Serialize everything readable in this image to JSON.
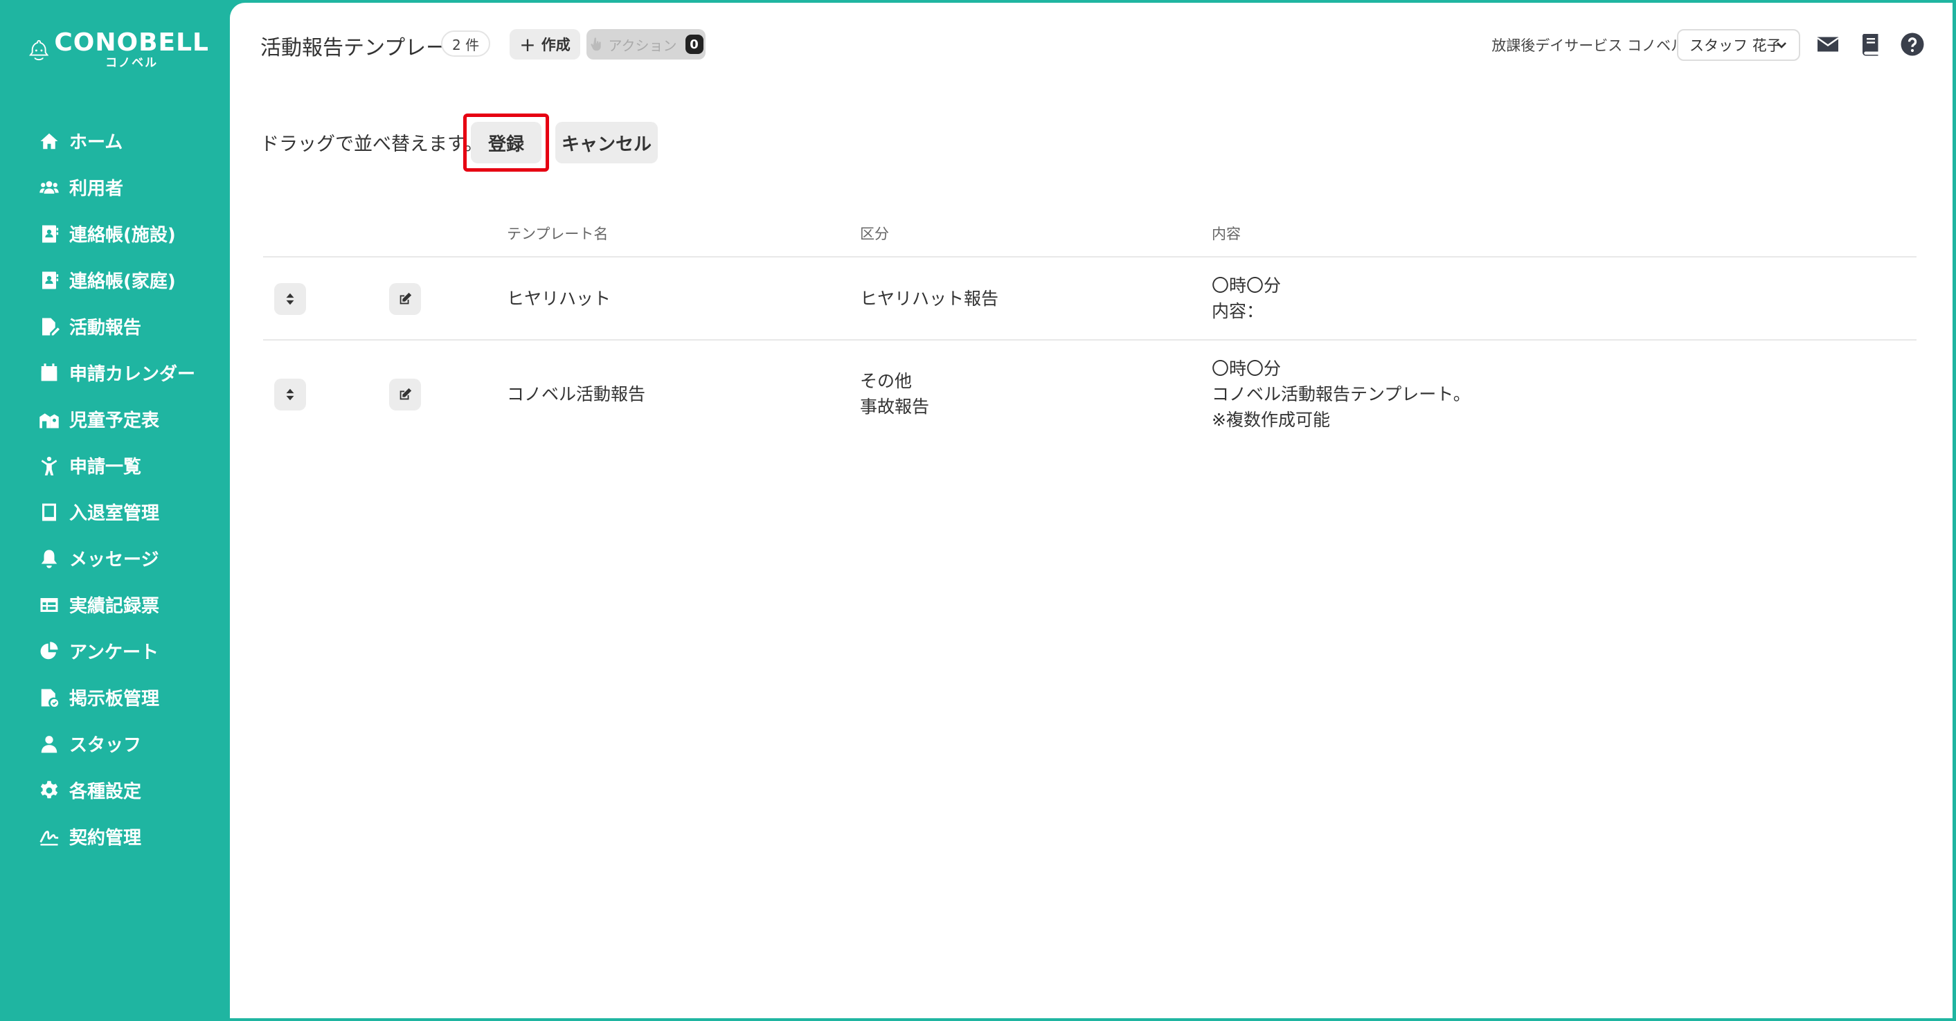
{
  "brand": {
    "name": "CONOBELL",
    "sub": "コノベル"
  },
  "sidebar": {
    "items": [
      {
        "label": "ホーム",
        "icon": "home-icon"
      },
      {
        "label": "利用者",
        "icon": "users-icon"
      },
      {
        "label": "連絡帳(施設)",
        "icon": "contact-book-icon"
      },
      {
        "label": "連絡帳(家庭)",
        "icon": "contact-book-icon"
      },
      {
        "label": "活動報告",
        "icon": "activity-report-icon"
      },
      {
        "label": "申請カレンダー",
        "icon": "calendar-icon"
      },
      {
        "label": "児童予定表",
        "icon": "schedule-icon"
      },
      {
        "label": "申請一覧",
        "icon": "child-icon"
      },
      {
        "label": "入退室管理",
        "icon": "tablet-icon"
      },
      {
        "label": "メッセージ",
        "icon": "bell-icon"
      },
      {
        "label": "実績記録票",
        "icon": "table-icon"
      },
      {
        "label": "アンケート",
        "icon": "pie-chart-icon"
      },
      {
        "label": "掲示板管理",
        "icon": "board-icon"
      },
      {
        "label": "スタッフ",
        "icon": "staff-icon"
      },
      {
        "label": "各種設定",
        "icon": "gear-icon"
      },
      {
        "label": "契約管理",
        "icon": "contract-icon"
      }
    ]
  },
  "header": {
    "title": "活動報告テンプレート",
    "count": "2 件",
    "create_label": "作成",
    "action_label": "アクション",
    "action_count": "0",
    "facility": "放課後デイサービス コノベル",
    "staff_name": "スタッフ 花子"
  },
  "sort": {
    "hint": "ドラッグで並べ替えます。",
    "register_label": "登録",
    "cancel_label": "キャンセル"
  },
  "table": {
    "columns": [
      "テンプレート名",
      "区分",
      "内容"
    ],
    "rows": [
      {
        "name": "ヒヤリハット",
        "category": [
          "ヒヤリハット報告"
        ],
        "content": [
          "〇時〇分",
          "内容："
        ]
      },
      {
        "name": "コノベル活動報告",
        "category": [
          "その他",
          "事故報告"
        ],
        "content": [
          "〇時〇分",
          "コノベル活動報告テンプレート。",
          "※複数作成可能"
        ]
      }
    ]
  },
  "colors": {
    "accent": "#1fb5a1",
    "highlight": "#e60012"
  }
}
